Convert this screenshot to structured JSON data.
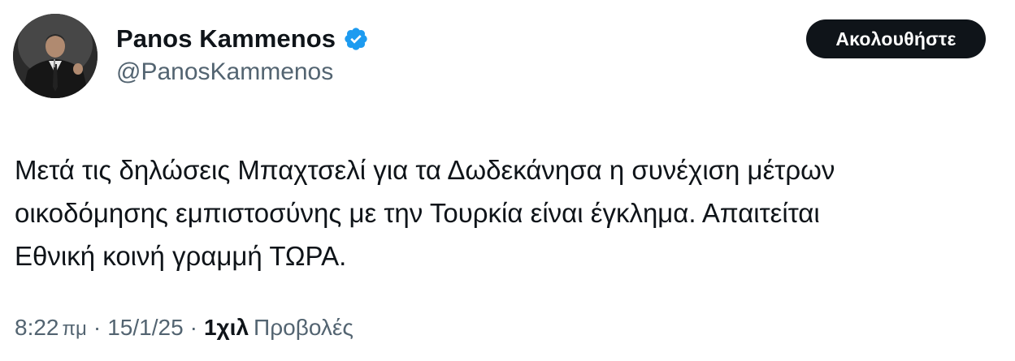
{
  "author": {
    "display_name": "Panos Kammenos",
    "handle": "@PanosKammenos",
    "verified_icon": "verified-badge-icon",
    "accent_color": "#1d9bf0"
  },
  "follow_button": {
    "label": "Ακολουθήστε"
  },
  "tweet": {
    "lines": [
      "Μετά τις δηλώσεις Μπαχτσελί για τα Δωδεκάνησα η συνέχιση μέτρων",
      "οικοδόμησης εμπιστοσύνης με την Τουρκία είναι έγκλημα. Απαιτείται",
      "Εθνική κοινή γραμμή ΤΩΡΑ."
    ]
  },
  "meta": {
    "time": "8:22",
    "ampm": "πμ",
    "separator": "·",
    "date": "15/1/25",
    "views_count": "1χιλ",
    "views_label": "Προβολές"
  }
}
